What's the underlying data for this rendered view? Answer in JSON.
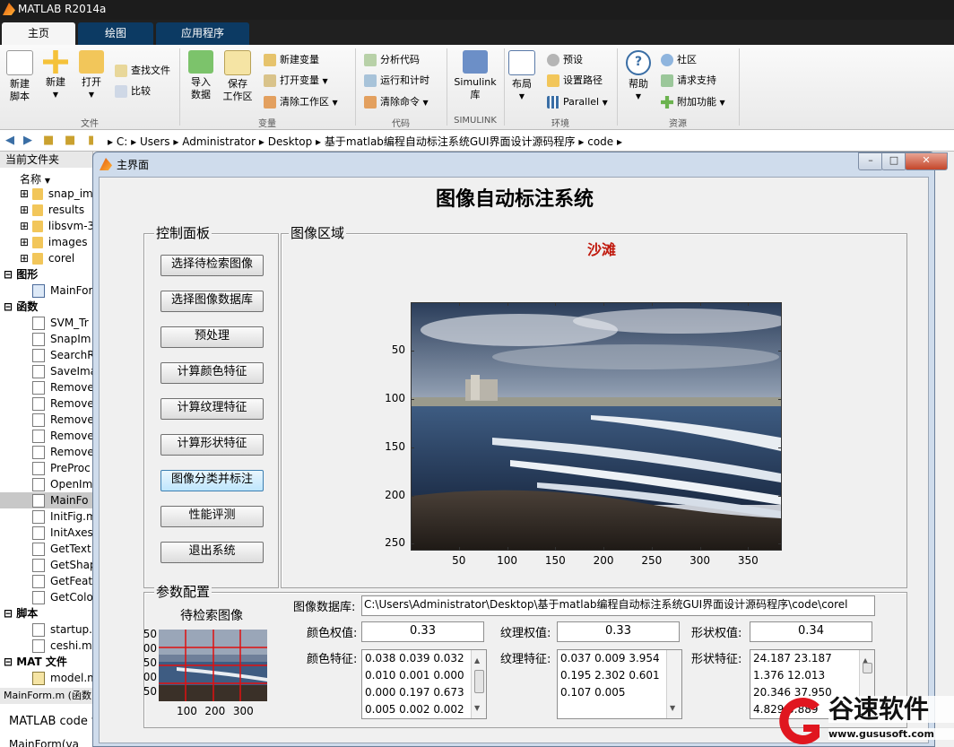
{
  "app": {
    "title": "MATLAB R2014a"
  },
  "ribbon": {
    "tabs": [
      "主页",
      "绘图",
      "应用程序"
    ],
    "sections": [
      "文件",
      "变量",
      "代码",
      "SIMULINK",
      "环境",
      "资源"
    ],
    "file": {
      "new_script": "新建\n脚本",
      "new": "新建",
      "open": "打开",
      "find_files": "查找文件",
      "compare": "比较"
    },
    "variable": {
      "import": "导入\n数据",
      "save_ws": "保存\n工作区",
      "new_var": "新建变量",
      "open_var": "打开变量",
      "clear_ws": "清除工作区"
    },
    "code": {
      "analyze": "分析代码",
      "run_time": "运行和计时",
      "clear_cmd": "清除命令"
    },
    "simulink": {
      "lib": "Simulink\n库"
    },
    "env": {
      "layout": "布局",
      "prefs": "预设",
      "set_path": "设置路径",
      "parallel": "Parallel"
    },
    "resources": {
      "help": "帮助",
      "community": "社区",
      "support": "请求支持",
      "addons": "附加功能"
    }
  },
  "address": {
    "crumbs": [
      "C:",
      "Users",
      "Administrator",
      "Desktop",
      "基于matlab编程自动标注系统GUI界面设计源码程序",
      "code"
    ]
  },
  "left_panel": {
    "header": "当前文件夹",
    "col_name": "名称",
    "rows": [
      {
        "name": "snap_im",
        "kind": "folder"
      },
      {
        "name": "results",
        "kind": "folder"
      },
      {
        "name": "libsvm-3",
        "kind": "folder"
      },
      {
        "name": "images",
        "kind": "folder"
      },
      {
        "name": "corel",
        "kind": "folder"
      },
      {
        "name": "图形",
        "kind": "group"
      },
      {
        "name": "MainFor",
        "kind": "fig"
      },
      {
        "name": "函数",
        "kind": "group"
      },
      {
        "name": "SVM_Tr",
        "kind": "m"
      },
      {
        "name": "SnapIm",
        "kind": "m"
      },
      {
        "name": "SearchR",
        "kind": "m"
      },
      {
        "name": "SaveIma",
        "kind": "m"
      },
      {
        "name": "Remove",
        "kind": "m"
      },
      {
        "name": "Remove",
        "kind": "m"
      },
      {
        "name": "Remove",
        "kind": "m"
      },
      {
        "name": "Remove",
        "kind": "m"
      },
      {
        "name": "Remove",
        "kind": "m"
      },
      {
        "name": "PreProc",
        "kind": "m"
      },
      {
        "name": "OpenIm",
        "kind": "m"
      },
      {
        "name": "MainFo",
        "kind": "m",
        "selected": true
      },
      {
        "name": "InitFig.m",
        "kind": "m"
      },
      {
        "name": "InitAxes",
        "kind": "m"
      },
      {
        "name": "GetText",
        "kind": "m"
      },
      {
        "name": "GetShap",
        "kind": "m"
      },
      {
        "name": "GetFeat",
        "kind": "m"
      },
      {
        "name": "GetColo",
        "kind": "m"
      },
      {
        "name": "脚本",
        "kind": "group"
      },
      {
        "name": "startup.",
        "kind": "m"
      },
      {
        "name": "ceshi.m",
        "kind": "m"
      },
      {
        "name": "MAT 文件",
        "kind": "group"
      },
      {
        "name": "model.m",
        "kind": "mat"
      }
    ],
    "detail_title": "MainForm.m (函数",
    "detail_text": "MATLAB code fo",
    "detail_item": "MainForm(va"
  },
  "figure": {
    "window_title": "主界面",
    "heading": "图像自动标注系统",
    "control_panel": {
      "title": "控制面板",
      "buttons": [
        "选择待检索图像",
        "选择图像数据库",
        "预处理",
        "计算颜色特征",
        "计算纹理特征",
        "计算形状特征",
        "图像分类并标注",
        "性能评测",
        "退出系统"
      ]
    },
    "image_panel": {
      "title": "图像区域",
      "annotation": "沙滩",
      "y_ticks": [
        "50",
        "100",
        "150",
        "200",
        "250"
      ],
      "x_ticks": [
        "50",
        "100",
        "150",
        "200",
        "250",
        "300",
        "350"
      ]
    },
    "params": {
      "title": "参数配置",
      "thumb_title": "待检索图像",
      "thumb_x_ticks": [
        "100",
        "200",
        "300"
      ],
      "thumb_y_ticks": [
        "50",
        "00",
        "50",
        "00",
        "50"
      ],
      "db_label": "图像数据库:",
      "db_path": "C:\\Users\\Administrator\\Desktop\\基于matlab编程自动标注系统GUI界面设计源码程序\\code\\corel",
      "color_w_label": "颜色权值:",
      "color_w": "0.33",
      "texture_w_label": "纹理权值:",
      "texture_w": "0.33",
      "shape_w_label": "形状权值:",
      "shape_w": "0.34",
      "color_f_label": "颜色特征:",
      "color_f": [
        "0.038 0.039 0.032",
        "0.010 0.001 0.000",
        "0.000 0.197 0.673",
        "0.005 0.002 0.002"
      ],
      "texture_f_label": "纹理特征:",
      "texture_f": [
        "0.037 0.009 3.954",
        "0.195 2.302 0.601",
        "0.107 0.005"
      ],
      "shape_f_label": "形状特征:",
      "shape_f": [
        "24.187 23.187",
        "1.376 12.013",
        "20.346 37.950",
        "4.829 5.889"
      ]
    }
  },
  "watermark": {
    "brand": "谷速软件",
    "url": "www.gususoft.com"
  }
}
